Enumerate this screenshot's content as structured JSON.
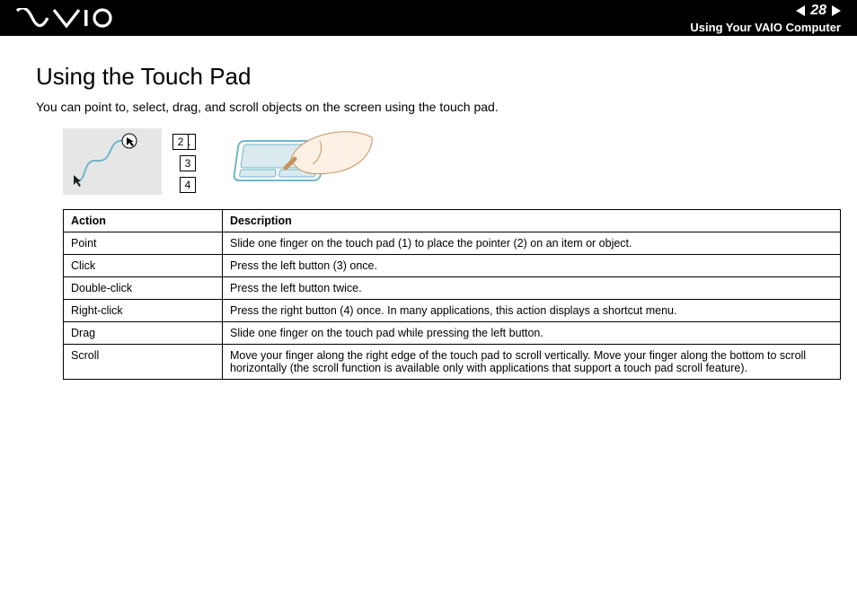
{
  "header": {
    "page_number": "28",
    "section": "Using Your VAIO Computer"
  },
  "page": {
    "title": "Using the Touch Pad",
    "intro": "You can point to, select, drag, and scroll objects on the screen using the touch pad."
  },
  "labels": {
    "l1": "1",
    "l2": "2",
    "l3": "3",
    "l4": "4"
  },
  "table": {
    "head_action": "Action",
    "head_desc": "Description",
    "rows": [
      {
        "action": "Point",
        "desc": "Slide one finger on the touch pad (1) to place the pointer (2) on an item or object."
      },
      {
        "action": "Click",
        "desc": "Press the left button (3) once."
      },
      {
        "action": "Double-click",
        "desc": "Press the left button twice."
      },
      {
        "action": "Right-click",
        "desc": "Press the right button (4) once. In many applications, this action displays a shortcut menu."
      },
      {
        "action": "Drag",
        "desc": "Slide one finger on the touch pad while pressing the left button."
      },
      {
        "action": "Scroll",
        "desc": "Move your finger along the right edge of the touch pad to scroll vertically. Move your finger along the bottom to scroll horizontally (the scroll function is available only with applications that support a touch pad scroll feature)."
      }
    ]
  }
}
